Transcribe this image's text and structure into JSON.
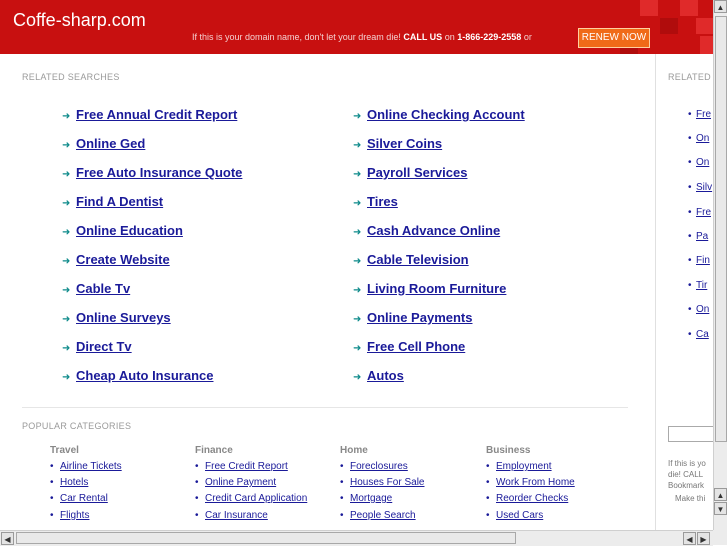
{
  "header": {
    "domain": "Coffe-sharp.com",
    "promo_text": "If this is your domain name, don't let your dream die!",
    "call_label": "CALL US",
    "on_text": "on",
    "phone": "1-866-229-2558",
    "or_text": "or",
    "renew_label": "RENEW NOW",
    "colors": {
      "brand_red": "#c81010",
      "renew_orange": "#f06a18"
    }
  },
  "related": {
    "label": "RELATED SEARCHES",
    "left": [
      "Free Annual Credit Report",
      "Online Ged",
      "Free Auto Insurance Quote",
      "Find A Dentist",
      "Online Education",
      "Create Website",
      "Cable Tv",
      "Online Surveys",
      "Direct Tv",
      "Cheap Auto Insurance"
    ],
    "right": [
      "Online Checking Account",
      "Silver Coins",
      "Payroll Services",
      "Tires",
      "Cash Advance Online",
      "Cable Television",
      "Living Room Furniture",
      "Online Payments",
      "Free Cell Phone",
      "Autos"
    ]
  },
  "popular": {
    "label": "POPULAR CATEGORIES",
    "columns": [
      {
        "title": "Travel",
        "items": [
          "Airline Tickets",
          "Hotels",
          "Car Rental",
          "Flights"
        ]
      },
      {
        "title": "Finance",
        "items": [
          "Free Credit Report",
          "Online Payment",
          "Credit Card Application",
          "Car Insurance"
        ]
      },
      {
        "title": "Home",
        "items": [
          "Foreclosures",
          "Houses For Sale",
          "Mortgage",
          "People Search"
        ]
      },
      {
        "title": "Business",
        "items": [
          "Employment",
          "Work From Home",
          "Reorder Checks",
          "Used Cars"
        ]
      }
    ]
  },
  "right_panel": {
    "label": "RELATED",
    "items": [
      "Fre",
      "On",
      "On",
      "Silv",
      "Fre",
      "Pa",
      "Fin",
      "Tir",
      "On",
      "Ca"
    ],
    "text_lines": [
      "If this is yo",
      "die! CALL",
      "Bookmark",
      "Make thi"
    ]
  }
}
